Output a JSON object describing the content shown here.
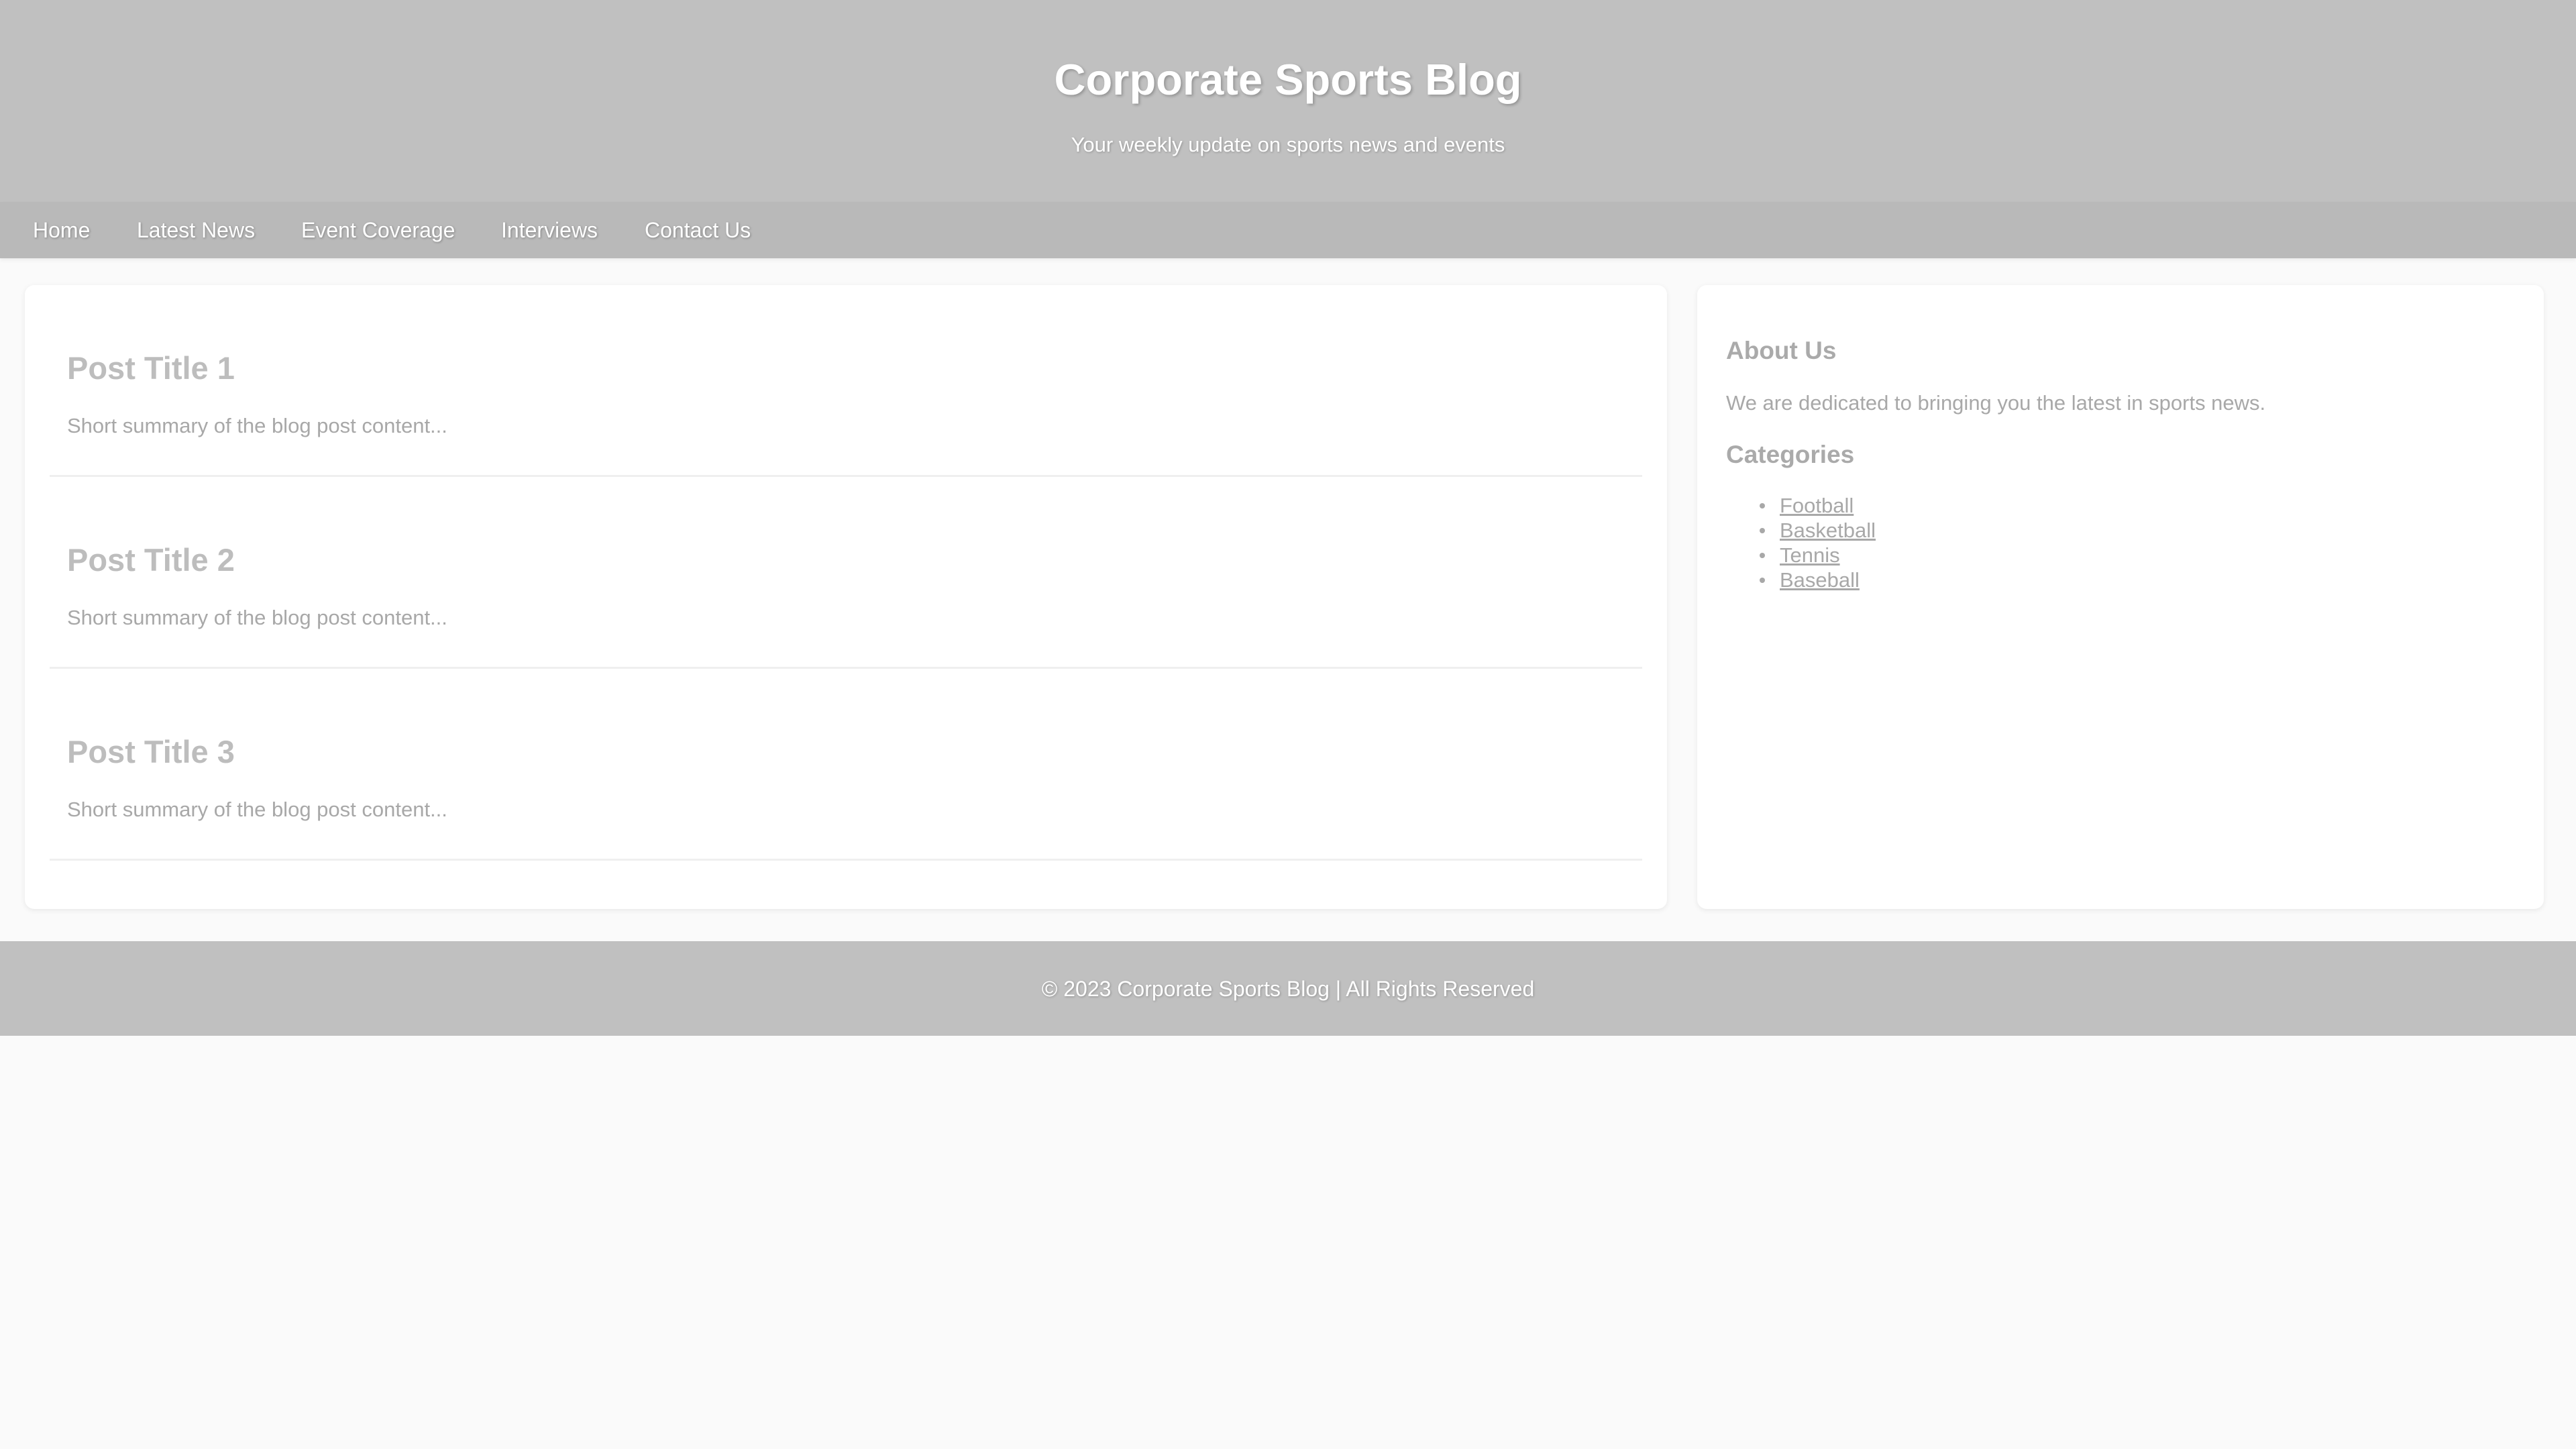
{
  "header": {
    "title": "Corporate Sports Blog",
    "tagline": "Your weekly update on sports news and events"
  },
  "nav": {
    "items": [
      {
        "label": "Home"
      },
      {
        "label": "Latest News"
      },
      {
        "label": "Event Coverage"
      },
      {
        "label": "Interviews"
      },
      {
        "label": "Contact Us"
      }
    ]
  },
  "posts": [
    {
      "title": "Post Title 1",
      "summary": "Short summary of the blog post content..."
    },
    {
      "title": "Post Title 2",
      "summary": "Short summary of the blog post content..."
    },
    {
      "title": "Post Title 3",
      "summary": "Short summary of the blog post content..."
    }
  ],
  "sidebar": {
    "about_heading": "About Us",
    "about_text": "We are dedicated to bringing you the latest in sports news.",
    "categories_heading": "Categories",
    "categories": [
      {
        "label": "Football"
      },
      {
        "label": "Basketball"
      },
      {
        "label": "Tennis"
      },
      {
        "label": "Baseball"
      }
    ]
  },
  "footer": {
    "text": "© 2023 Corporate Sports Blog | All Rights Reserved"
  },
  "colors": {
    "header_bg": "#c0c0c0",
    "nav_bg": "#b9b9b9",
    "page_bg": "#fafafa",
    "card_bg": "#ffffff",
    "post_title": "#bdbdbd",
    "body_text": "#a8a8a8"
  }
}
